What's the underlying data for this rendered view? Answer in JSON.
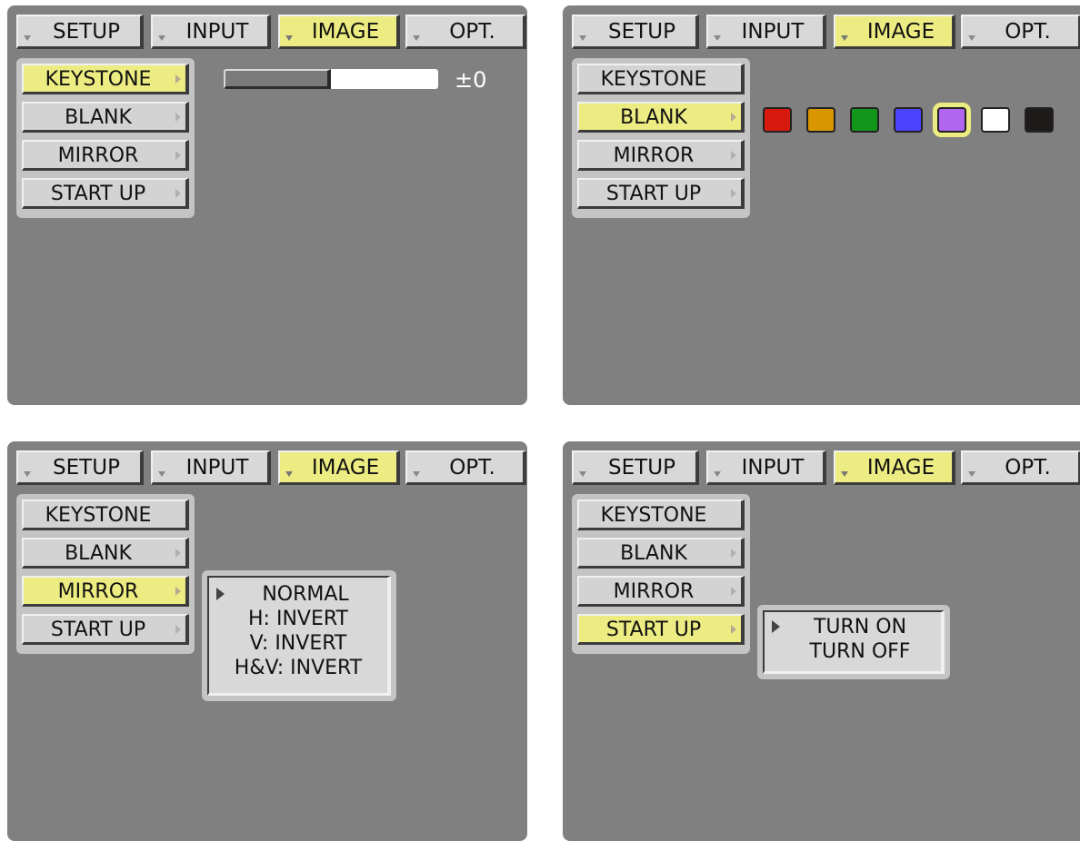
{
  "tabs": [
    "SETUP",
    "INPUT",
    "IMAGE",
    "OPT."
  ],
  "active_tab": "IMAGE",
  "menu_items": [
    "KEYSTONE",
    "BLANK",
    "MIRROR",
    "START UP"
  ],
  "panels": [
    {
      "active_item": "KEYSTONE",
      "keystone": {
        "value_label": "±0",
        "position": 0.5
      }
    },
    {
      "active_item": "BLANK",
      "blank_colors": [
        "#d81a0e",
        "#d89600",
        "#12961a",
        "#4a44ff",
        "#b066ee",
        "#ffffff",
        "#1e1a1a"
      ],
      "selected_color_index": 4
    },
    {
      "active_item": "MIRROR",
      "mirror_options": [
        "NORMAL",
        "H: INVERT",
        "V: INVERT",
        "H&V: INVERT"
      ],
      "selected_option": "NORMAL"
    },
    {
      "active_item": "START UP",
      "startup_options": [
        "TURN ON",
        "TURN OFF"
      ],
      "selected_option": "TURN ON"
    }
  ],
  "colors": {
    "screen_bg": "#808080",
    "highlight": "#ecec82",
    "menu_bg": "#c4c4c4",
    "item_bg": "#d3d3d3"
  }
}
